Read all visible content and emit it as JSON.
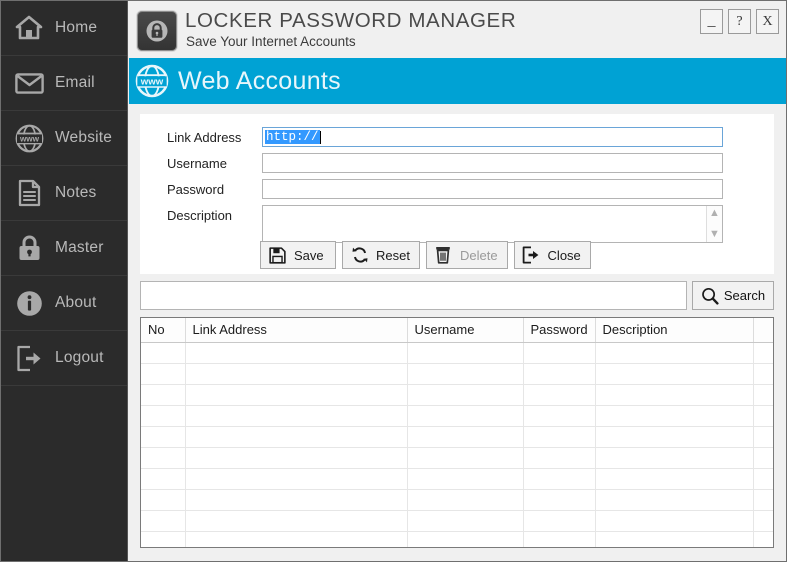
{
  "sidebar": {
    "items": [
      {
        "label": "Home",
        "icon": "home-icon"
      },
      {
        "label": "Email",
        "icon": "envelope-icon"
      },
      {
        "label": "Website",
        "icon": "globe-www-icon"
      },
      {
        "label": "Notes",
        "icon": "document-lines-icon"
      },
      {
        "label": "Master",
        "icon": "padlock-icon"
      },
      {
        "label": "About",
        "icon": "info-circle-icon"
      },
      {
        "label": "Logout",
        "icon": "exit-arrow-icon"
      }
    ]
  },
  "titlebar": {
    "app_icon": "padlock-app-icon",
    "title": "LOCKER PASSWORD MANAGER",
    "subtitle": "Save Your Internet Accounts",
    "window_buttons": [
      {
        "label": "_",
        "name": "minimize-button"
      },
      {
        "label": "?",
        "name": "help-button"
      },
      {
        "label": "X",
        "name": "close-window-button"
      }
    ]
  },
  "banner": {
    "icon": "globe-www-icon",
    "title": "Web Accounts",
    "color": "#00a2d4"
  },
  "form": {
    "labels": {
      "link": "Link Address",
      "username": "Username",
      "password": "Password",
      "description": "Description"
    },
    "values": {
      "link": "http://",
      "username": "",
      "password": "",
      "description": ""
    },
    "link_selected": true,
    "selection_color": "#3399ff"
  },
  "buttons": [
    {
      "label": "Save",
      "icon": "floppy-disk-icon",
      "disabled": false
    },
    {
      "label": "Reset",
      "icon": "refresh-arrows-icon",
      "disabled": false
    },
    {
      "label": "Delete",
      "icon": "trash-can-icon",
      "disabled": true
    },
    {
      "label": "Close",
      "icon": "exit-arrow-icon",
      "disabled": false
    }
  ],
  "search": {
    "value": "",
    "placeholder": "",
    "button_label": "Search",
    "button_icon": "magnifier-icon"
  },
  "grid": {
    "columns": [
      "No",
      "Link Address",
      "Username",
      "Password",
      "Description"
    ],
    "rows": [],
    "empty_row_count": 10
  }
}
